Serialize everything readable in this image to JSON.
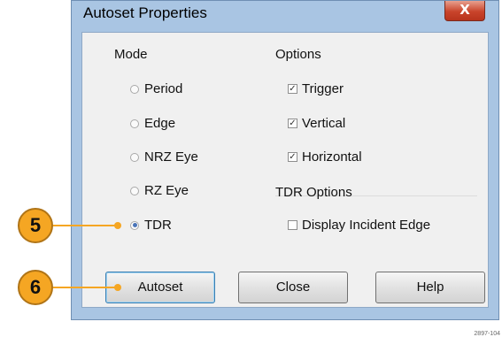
{
  "dialog": {
    "title": "Autoset Properties",
    "close_icon": "close-icon",
    "close_glyph": "X"
  },
  "mode": {
    "heading": "Mode",
    "options": [
      {
        "label": "Period",
        "selected": false
      },
      {
        "label": "Edge",
        "selected": false
      },
      {
        "label": "NRZ Eye",
        "selected": false
      },
      {
        "label": "RZ Eye",
        "selected": false
      },
      {
        "label": "TDR",
        "selected": true
      }
    ]
  },
  "options": {
    "heading": "Options",
    "items": [
      {
        "label": "Trigger",
        "checked": true
      },
      {
        "label": "Vertical",
        "checked": true
      },
      {
        "label": "Horizontal",
        "checked": true
      }
    ]
  },
  "tdr_options": {
    "heading": "TDR Options",
    "items": [
      {
        "label": "Display Incident Edge",
        "checked": false
      }
    ]
  },
  "buttons": {
    "autoset": "Autoset",
    "close": "Close",
    "help": "Help"
  },
  "callouts": [
    "5",
    "6"
  ],
  "figure_id": "2897-104",
  "colors": {
    "frame": "#a9c5e3",
    "client": "#f0f0f0",
    "callout": "#f5a623",
    "close_button": "#c9442b"
  }
}
